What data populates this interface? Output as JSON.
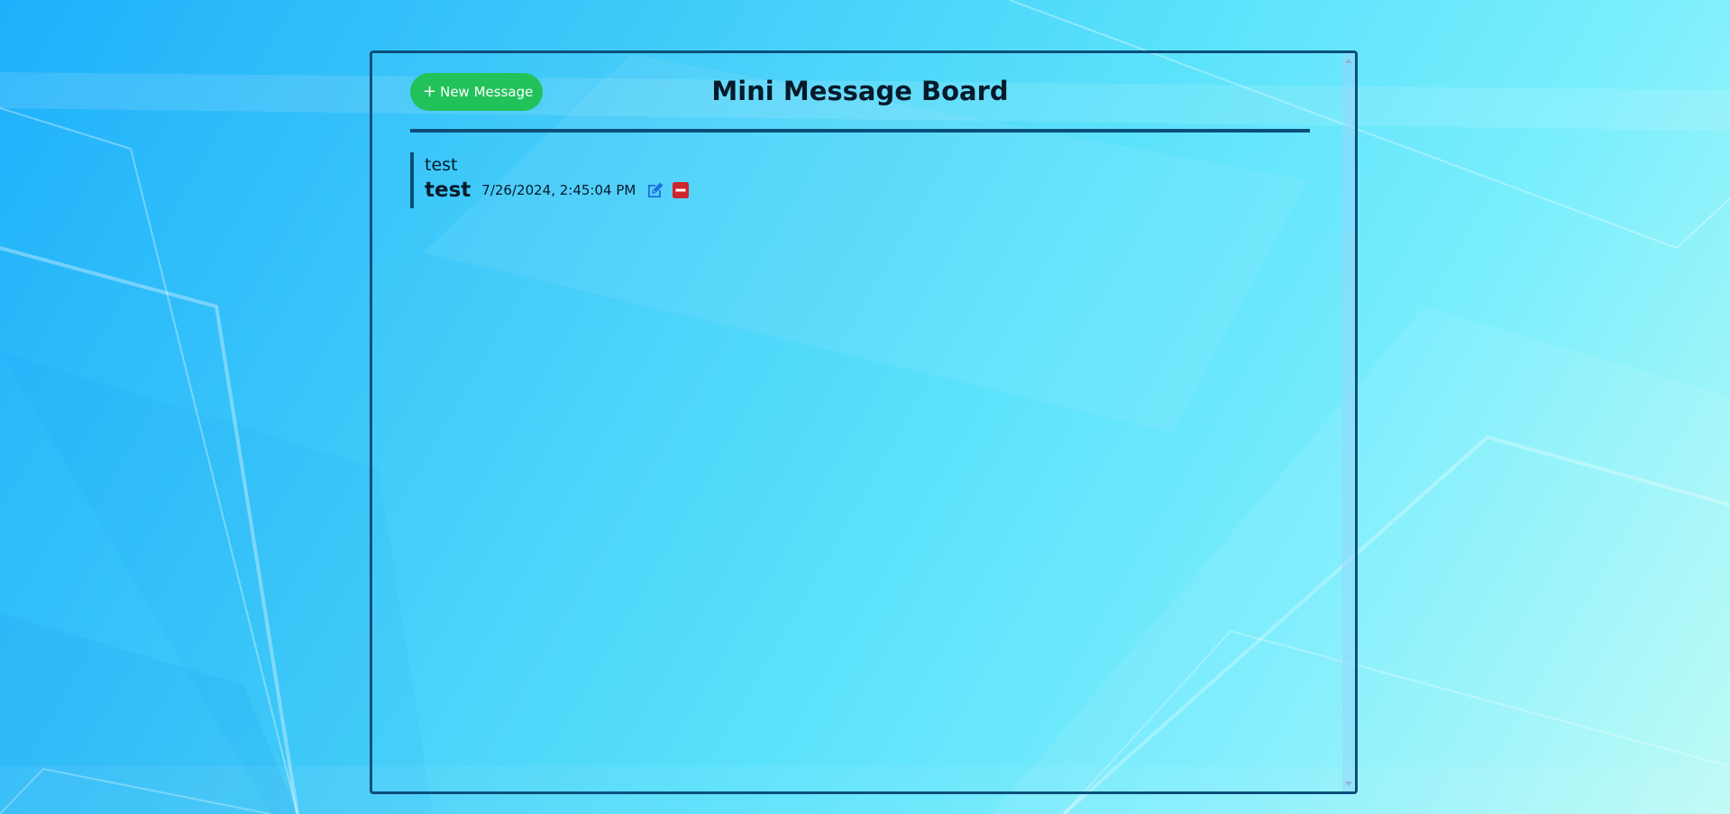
{
  "header": {
    "new_button_label": "New Message",
    "title": "Mini Message Board"
  },
  "messages": [
    {
      "text": "test",
      "author": "test",
      "date": "7/26/2024, 2:45:04 PM"
    }
  ],
  "icons": {
    "new": "plus-icon",
    "edit": "edit-icon",
    "delete": "delete-icon"
  },
  "colors": {
    "accent": "#22c25b",
    "border": "#0b4f7a",
    "edit": "#1d6fe0",
    "delete": "#d0252a"
  }
}
